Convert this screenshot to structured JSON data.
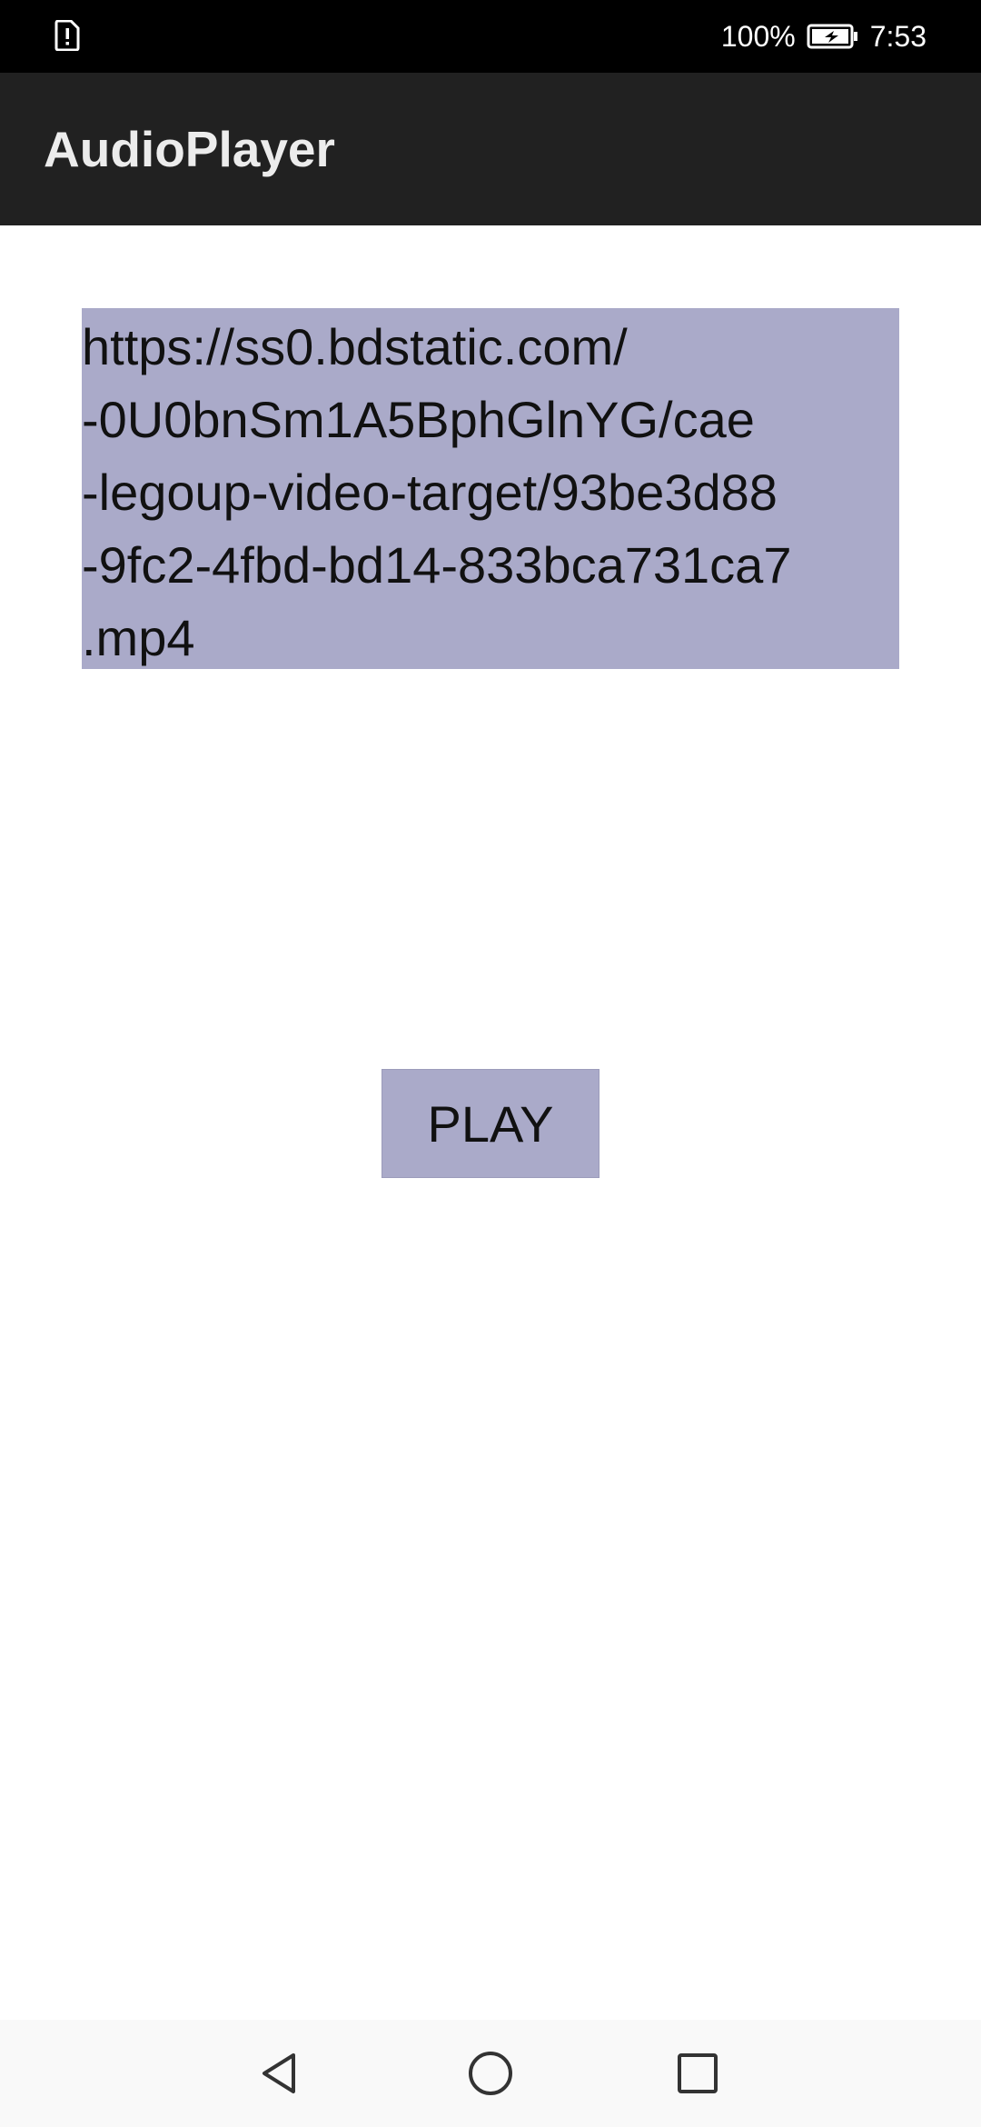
{
  "status_bar": {
    "left_icon": "sim-alert-icon",
    "battery_percent": "100%",
    "battery_icon": "battery-charging-icon",
    "time": "7:53"
  },
  "app_bar": {
    "title": "AudioPlayer"
  },
  "main": {
    "url_text": "https://ss0.bdstatic.com/\n-0U0bnSm1A5BphGlnYG/cae\n-legoup-video-target/93be3d88\n-9fc2-4fbd-bd14-833bca731ca7\n.mp4",
    "play_label": "PLAY"
  },
  "nav_bar": {
    "back_icon": "back-triangle-icon",
    "home_icon": "home-circle-icon",
    "recent_icon": "recent-square-icon"
  },
  "colors": {
    "status_bar": "#000000",
    "app_bar": "#212121",
    "highlight": "#aaaac9",
    "nav_bar": "#f9f9f9"
  }
}
